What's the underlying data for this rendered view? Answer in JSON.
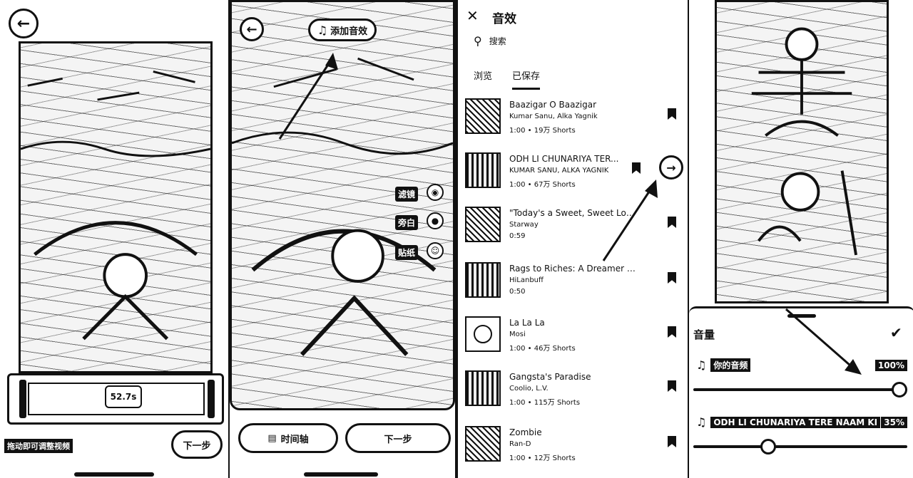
{
  "panel1": {
    "back_icon": "arrow-left-icon",
    "duration": "52.7s",
    "hint": "拖动即可调整视频",
    "next_label": "下一步"
  },
  "panel2": {
    "back_icon": "arrow-left-icon",
    "add_sound_label": "添加音效",
    "tools": [
      "滤镜",
      "旁白",
      "贴纸"
    ],
    "timeline_label": "时间轴",
    "next_label": "下一步"
  },
  "panel3": {
    "title": "音效",
    "search_placeholder": "搜索",
    "tabs": [
      "浏览",
      "已保存"
    ],
    "active_tab": 1,
    "tracks": [
      {
        "name": "Baazigar O Baazigar",
        "artist": "Kumar Sanu, Alka Yagnik",
        "meta": "1:00 • 19万 Shorts"
      },
      {
        "name": "ODH LI CHUNARIYA TER...",
        "artist": "KUMAR SANU, ALKA YAGNIK",
        "meta": "1:00 • 67万 Shorts"
      },
      {
        "name": "\"Today's a Sweet, Sweet Love Stor...",
        "artist": "Starway",
        "meta": "0:59"
      },
      {
        "name": "Rags to Riches: A Dreamer Born fr...",
        "artist": "HiLanbuff",
        "meta": "0:50"
      },
      {
        "name": "La La La",
        "artist": "Mosi",
        "meta": "1:00 • 46万 Shorts"
      },
      {
        "name": "Gangsta's Paradise",
        "artist": "Coolio, L.V.",
        "meta": "1:00 • 115万 Shorts"
      },
      {
        "name": "Zombie",
        "artist": "Ran-D",
        "meta": "1:00 • 12万 Shorts"
      }
    ]
  },
  "panel4": {
    "volume_title": "音量",
    "your_sound_label": "你的音频",
    "your_sound_pct": "100%",
    "your_sound_level": 1.0,
    "track_label": "ODH LI CHUNARIYA TERE NAAM KI",
    "track_pct": "35%",
    "track_level": 0.35
  }
}
